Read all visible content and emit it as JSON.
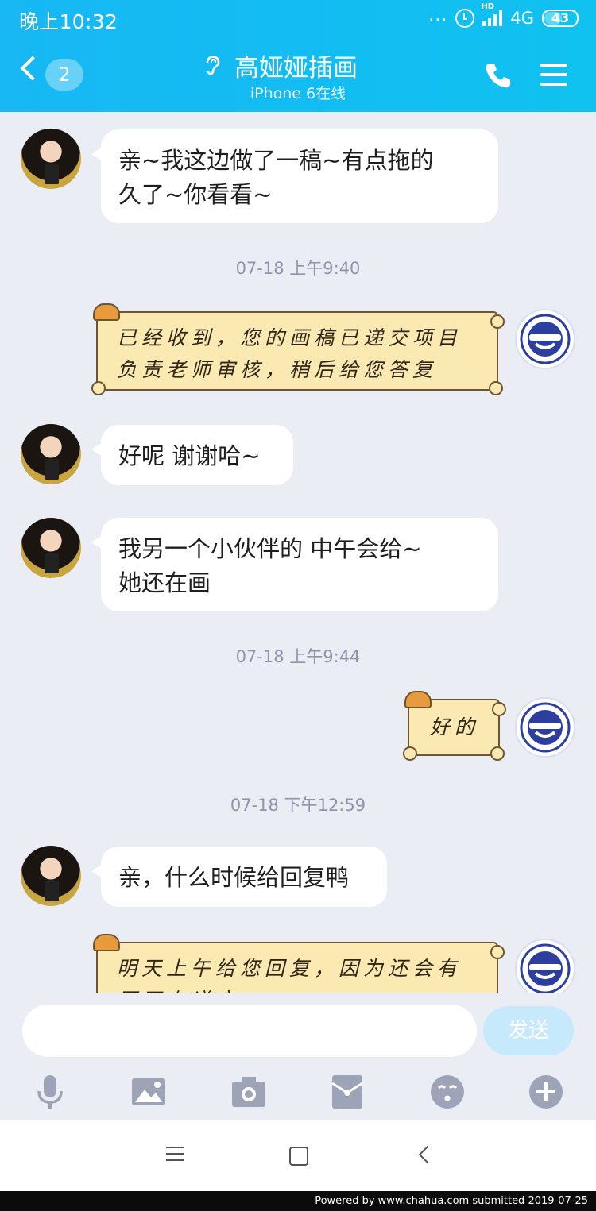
{
  "status_bar": {
    "time": "晚上10:32",
    "dots": "...",
    "hd": "HD",
    "network": "4G",
    "battery": "43"
  },
  "header": {
    "unread_count": "2",
    "title": "高娅娅插画",
    "subtitle": "iPhone 6在线"
  },
  "messages": [
    {
      "side": "left",
      "text_lines": [
        "亲~我这边做了一稿~有点拖的",
        "久了~你看看~"
      ]
    },
    {
      "type": "timestamp",
      "text": "07-18 上午9:40"
    },
    {
      "side": "right",
      "style": "cat-bubble",
      "text_lines": [
        "已经收到，您的画稿已递交项目",
        "负责老师审核，稍后给您答复"
      ]
    },
    {
      "side": "left",
      "text_lines": [
        "好呢 谢谢哈~"
      ]
    },
    {
      "side": "left",
      "text_lines": [
        "我另一个小伙伴的 中午会给~",
        "她还在画"
      ]
    },
    {
      "type": "timestamp",
      "text": "07-18 上午9:44"
    },
    {
      "side": "right",
      "style": "cat-bubble",
      "text_lines": [
        "好的"
      ]
    },
    {
      "type": "timestamp",
      "text": "07-18 下午12:59"
    },
    {
      "side": "left",
      "text_lines": [
        "亲，什么时候给回复鸭"
      ]
    },
    {
      "side": "right",
      "style": "cat-bubble",
      "text_lines": [
        "明天上午给您回复，因为还会有",
        "原画在递交"
      ]
    }
  ],
  "input": {
    "placeholder": "",
    "send_label": "发送"
  },
  "toolbar_icons": [
    "microphone-icon",
    "image-icon",
    "camera-icon",
    "red-packet-icon",
    "emoji-icon",
    "plus-icon"
  ],
  "nav_icons": [
    "menu-icon",
    "home-icon",
    "back-icon"
  ],
  "footer": {
    "text": "Powered  by  www.chahua.com  submitted  2019-07-25"
  },
  "colors": {
    "header": "#12bdf2",
    "background": "#ebedf5",
    "cat_bubble": "#fbe9b2",
    "send_button": "#c6e9fb"
  }
}
